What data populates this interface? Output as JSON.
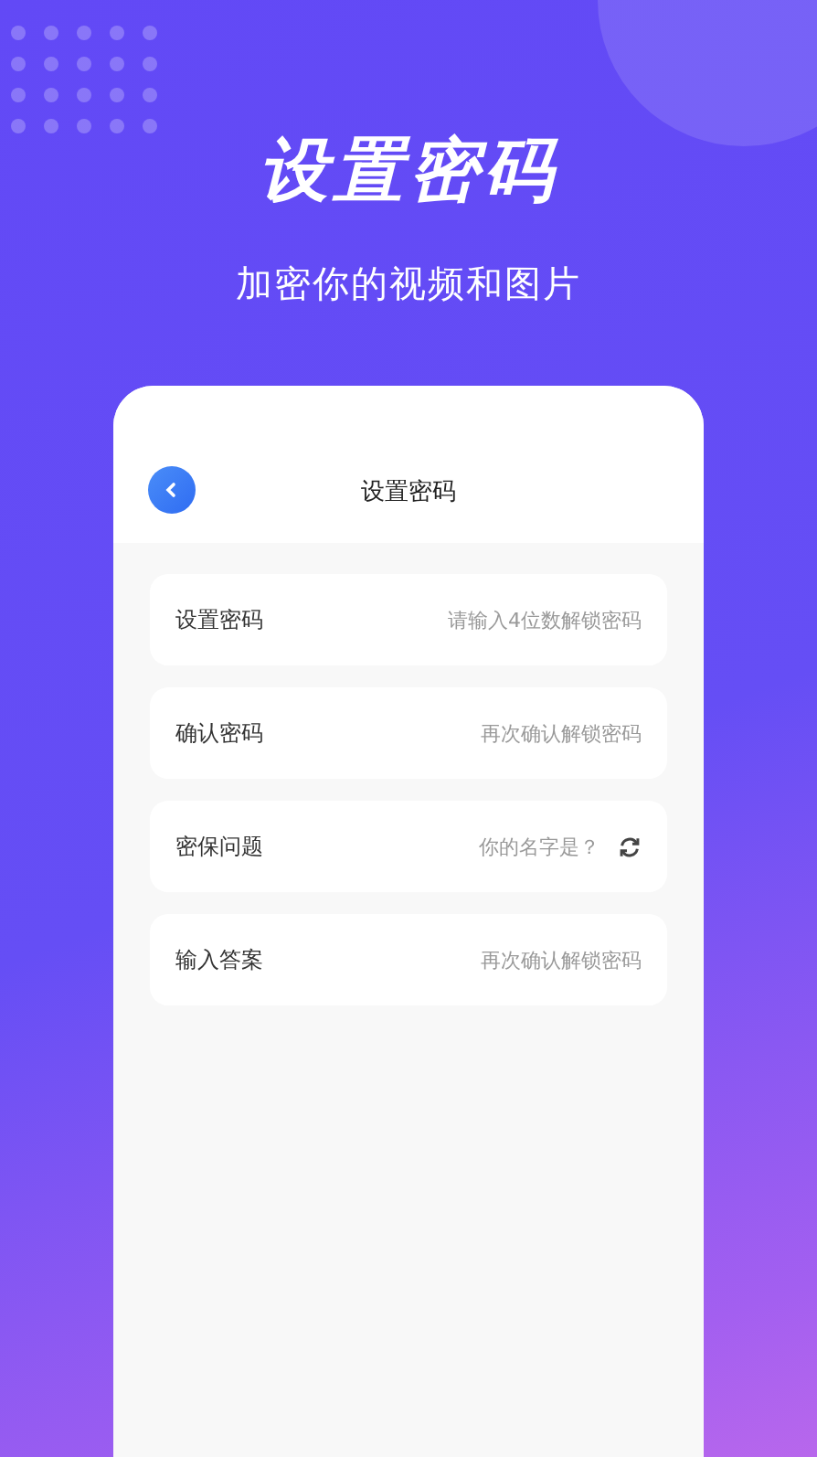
{
  "headline": "设置密码",
  "subtitle": "加密你的视频和图片",
  "screen": {
    "title": "设置密码",
    "rows": [
      {
        "kind": "input",
        "label": "设置密码",
        "placeholder": "请输入4位数解锁密码"
      },
      {
        "kind": "input",
        "label": "确认密码",
        "placeholder": "再次确认解锁密码"
      },
      {
        "kind": "question",
        "label": "密保问题",
        "value": "你的名字是？"
      },
      {
        "kind": "input",
        "label": "输入答案",
        "placeholder": "再次确认解锁密码"
      }
    ]
  }
}
